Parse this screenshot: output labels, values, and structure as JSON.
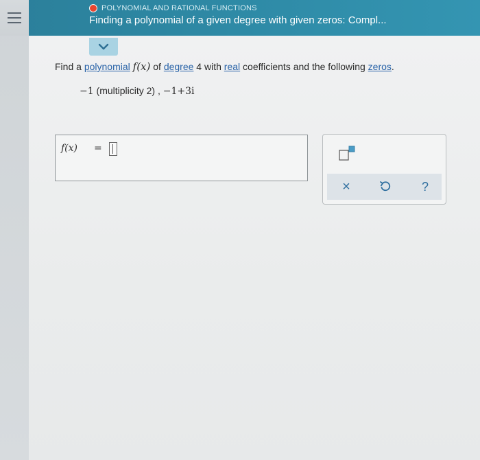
{
  "header": {
    "topic": "POLYNOMIAL AND RATIONAL FUNCTIONS",
    "title": "Finding a polynomial of a given degree with given zeros: Compl..."
  },
  "question": {
    "part1": "Find a ",
    "link_polynomial": "polynomial",
    "func": "f(x)",
    "part2": " of ",
    "link_degree": "degree",
    "part3": " 4 with ",
    "link_real": "real",
    "part4": " coefficients and the following ",
    "link_zeros": "zeros",
    "part5": ".",
    "zero1_value": "−1",
    "zero1_note": " (multiplicity 2) ,  ",
    "zero2_value": "−1+3i"
  },
  "answer": {
    "label": "f(x)",
    "equals": "="
  },
  "toolbar": {
    "clear_label": "×",
    "help_label": "?"
  },
  "colors": {
    "header_bg": "#2e8aa6",
    "link": "#2a63a8",
    "status_dot": "#e8452f",
    "tool_icon": "#2f6f9f"
  }
}
